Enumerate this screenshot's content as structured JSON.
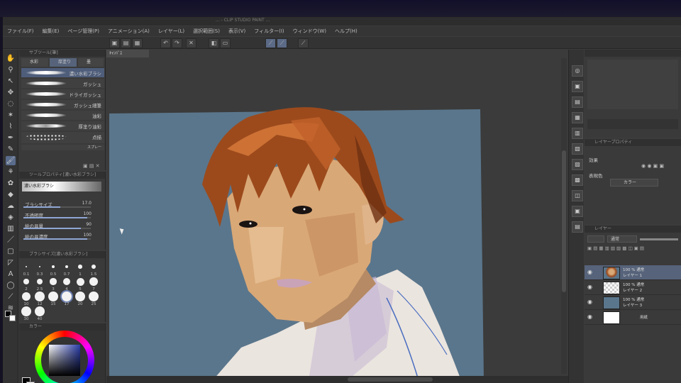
{
  "window": {
    "title": "... - CLIP STUDIO PAINT ..."
  },
  "menu": [
    "ファイル(F)",
    "編集(E)",
    "ページ管理(P)",
    "アニメーション(A)",
    "レイヤー(L)",
    "選択範囲(S)",
    "表示(V)",
    "フィルター(I)",
    "ウィンドウ(W)",
    "ヘルプ(H)"
  ],
  "canvas": {
    "tab_label": "ｷｬﾝﾊﾞｽ"
  },
  "subtool": {
    "title": "サブツール[筆]",
    "tabs": [
      "水彩",
      "厚塗り",
      "墨"
    ],
    "brushes": [
      "濃い水彩ブラシ",
      "ガッシュ",
      "ドライガッシュ",
      "ガッシュ細筆",
      "油彩",
      "厚塗り油彩",
      "点描",
      "スプレー"
    ]
  },
  "tool_property": {
    "title": "ツールプロパティ[濃い水彩ブラシ]",
    "brush_name": "濃い水彩ブラシ",
    "rows": [
      {
        "label": "ブラシサイズ",
        "value": "17.0",
        "level": 0.55
      },
      {
        "label": "不透明度",
        "value": "100",
        "level": 0.95
      },
      {
        "label": "絵の具量",
        "value": "90",
        "level": 0.85
      },
      {
        "label": "絵の具濃度",
        "value": "100",
        "level": 0.95
      }
    ]
  },
  "brush_size": {
    "title": "ブラシサイズ[濃い水彩ブラシ]",
    "sizes": [
      "0.1",
      "0.3",
      "0.5",
      "0.7",
      "1",
      "1.5",
      "2",
      "2.5",
      "3",
      "4",
      "5",
      "7",
      "10",
      "12",
      "15",
      "17",
      "20",
      "25",
      "30",
      "40"
    ]
  },
  "color_panel": {
    "title": "カラー"
  },
  "layer_property": {
    "title": "レイヤープロパティ",
    "effect_label": "効果",
    "expression_label": "表現色",
    "expression_value": "カラー"
  },
  "layers": [
    {
      "mode": "100 % 通常",
      "name": "レイヤー 1",
      "selected": true
    },
    {
      "mode": "100 % 通常",
      "name": "レイヤー 2",
      "selected": false
    },
    {
      "mode": "100 % 通常",
      "name": "レイヤー 3",
      "selected": false
    },
    {
      "mode": "",
      "name": "用紙",
      "selected": false
    }
  ],
  "layer_panel": {
    "title": "レイヤー",
    "blend_mode": "通常"
  },
  "colors": {
    "canvas_bg": "#5a768c",
    "hair": "#9c4a1c",
    "skin": "#d9a877",
    "shirt": "#e8e2dc",
    "accent": "#5a6c8c"
  }
}
